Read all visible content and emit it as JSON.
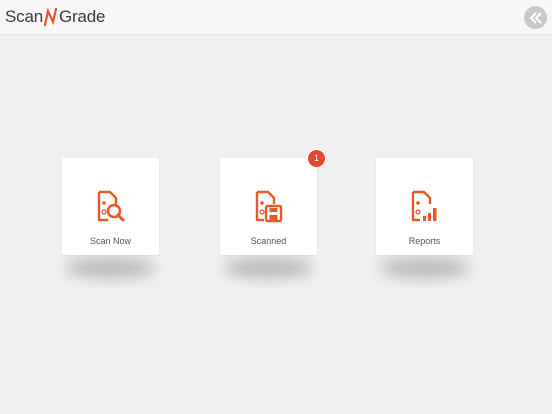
{
  "header": {
    "logo_left": "Scan",
    "logo_right": "Grade",
    "collapse_icon": "double-chevron-left-icon"
  },
  "colors": {
    "accent": "#e8582b",
    "badge": "#e8462b",
    "background": "#efefef",
    "header": "#f7f7f7"
  },
  "tiles": [
    {
      "label": "Scan Now",
      "icon": "scan-document-magnifier-icon"
    },
    {
      "label": "Scanned",
      "icon": "scanned-document-save-icon",
      "badge": "1"
    },
    {
      "label": "Reports",
      "icon": "report-document-bar-chart-icon"
    }
  ]
}
